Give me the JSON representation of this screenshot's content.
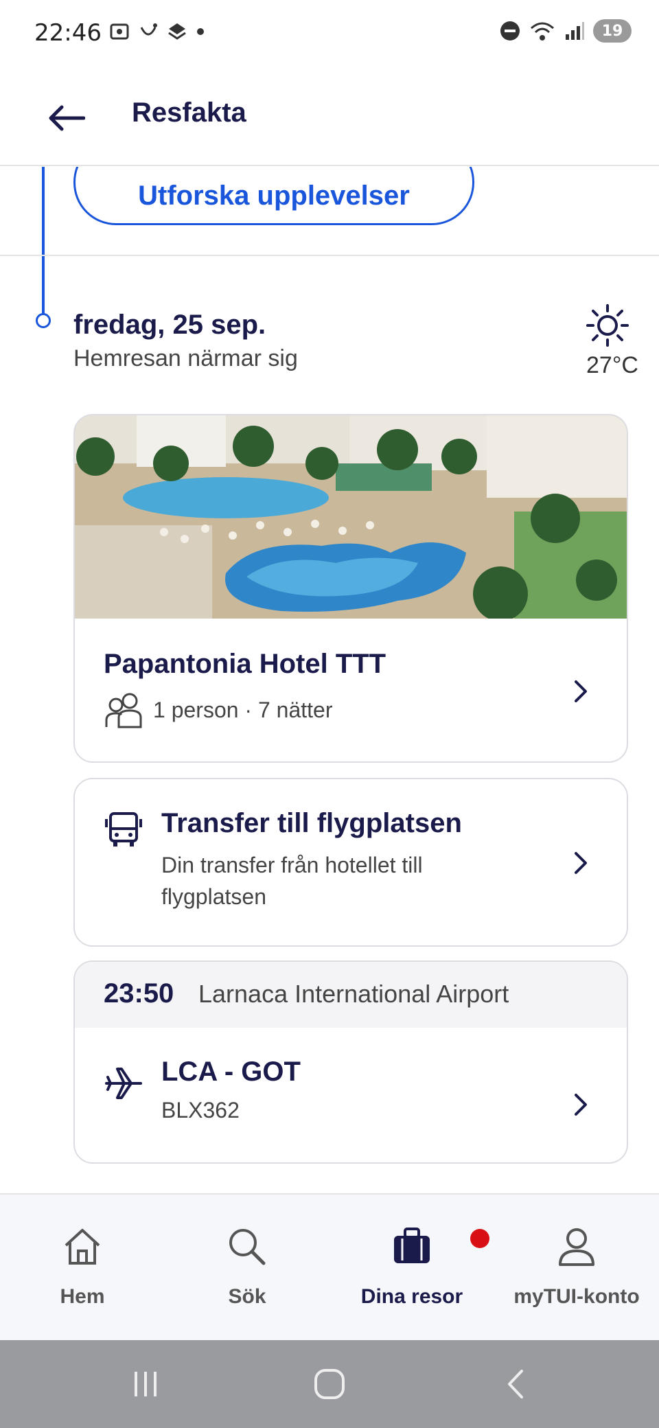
{
  "status_bar": {
    "time": "22:46",
    "battery": "19"
  },
  "header": {
    "title": "Resfakta"
  },
  "explore": {
    "label": "Utforska upplevelser"
  },
  "day": {
    "title": "fredag, 25 sep.",
    "subtitle": "Hemresan närmar sig",
    "weather_icon": "sun-icon",
    "temperature": "27°C"
  },
  "hotel": {
    "name": "Papantonia Hotel TTT",
    "details": "1 person · 7 nätter"
  },
  "transfer": {
    "title": "Transfer till flygplatsen",
    "description": "Din transfer från hotellet till flygplatsen"
  },
  "flight": {
    "time": "23:50",
    "airport": "Larnaca International Airport",
    "route": "LCA - GOT",
    "number": "BLX362"
  },
  "bottom_nav": {
    "items": [
      {
        "label": "Hem",
        "icon": "home-icon"
      },
      {
        "label": "Sök",
        "icon": "search-icon"
      },
      {
        "label": "Dina resor",
        "icon": "suitcase-icon",
        "active": true
      },
      {
        "label": "myTUI-konto",
        "icon": "user-icon"
      }
    ]
  },
  "colors": {
    "brand_navy": "#1a1a4b",
    "accent_blue": "#1a56db",
    "notification_red": "#d90f16"
  }
}
